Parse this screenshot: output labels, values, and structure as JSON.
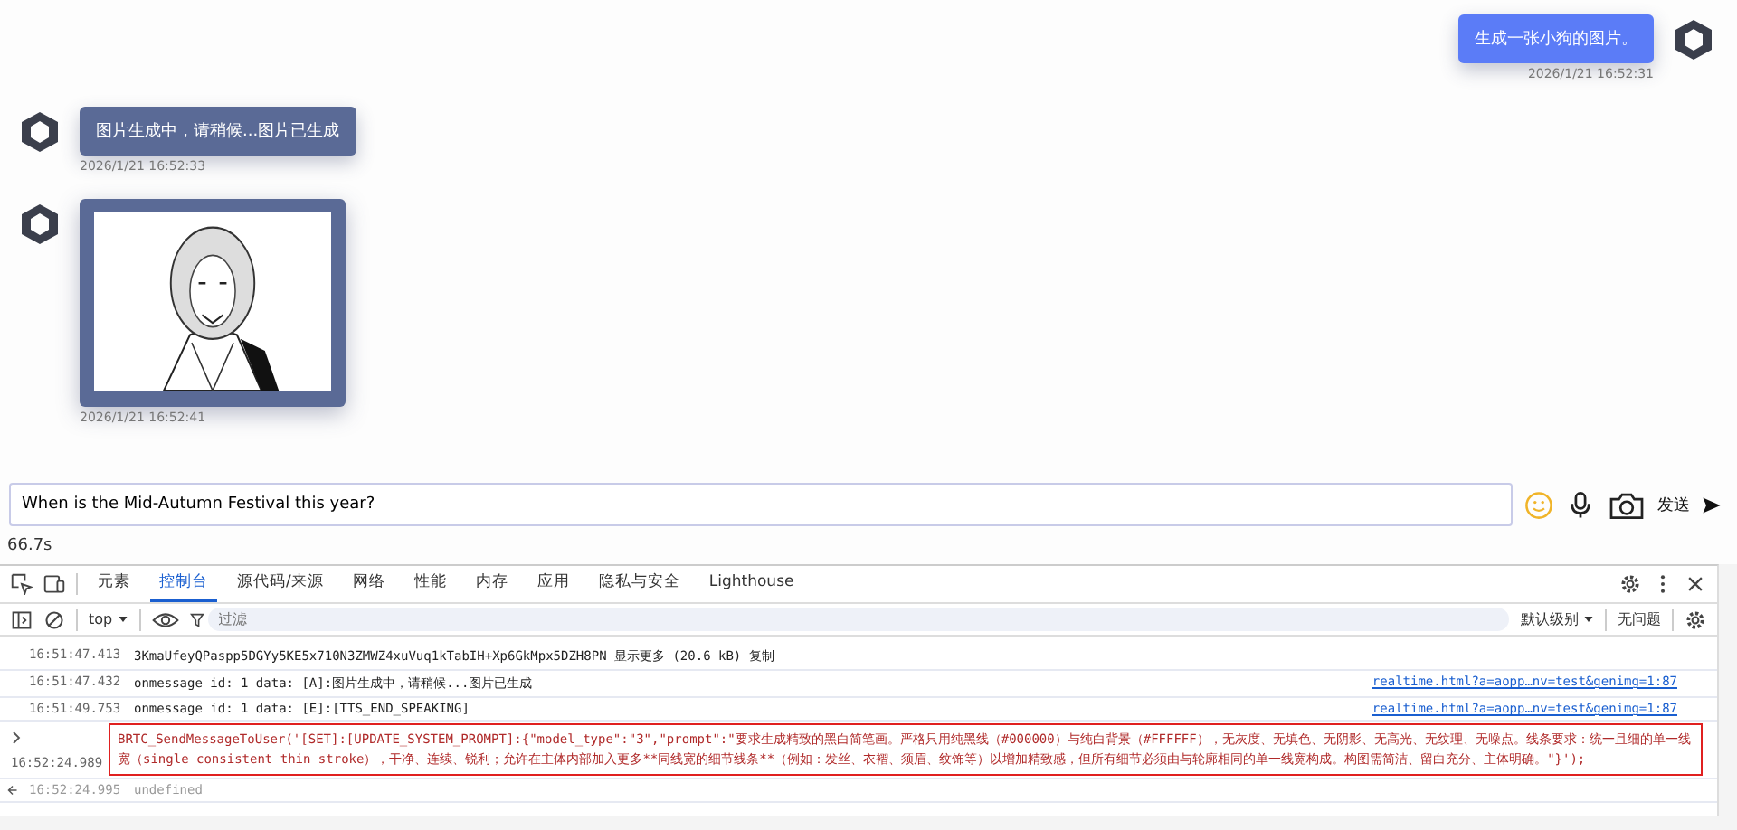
{
  "chat": {
    "messages": [
      {
        "kind": "user",
        "text": "生成一张小狗的图片。",
        "time": "2026/1/21 16:52:31"
      },
      {
        "kind": "bot",
        "text": "图片生成中，请稍候...图片已生成",
        "time": "2026/1/21 16:52:33"
      },
      {
        "time": "2026/1/21 16:52:41"
      }
    ]
  },
  "composer": {
    "value": "When is the Mid-Autumn Festival this year?",
    "send": "发送"
  },
  "elapsed": "66.7s",
  "devtools": {
    "tabs": [
      {
        "label": "元素",
        "selected": false
      },
      {
        "label": "控制台",
        "selected": true
      },
      {
        "label": "源代码/来源",
        "selected": false
      },
      {
        "label": "网络",
        "selected": false
      },
      {
        "label": "性能",
        "selected": false
      },
      {
        "label": "内存",
        "selected": false
      },
      {
        "label": "应用",
        "selected": false
      },
      {
        "label": "隐私与安全",
        "selected": false
      },
      {
        "label": "Lighthouse",
        "selected": false
      }
    ],
    "context": "top",
    "filter_placeholder": "过滤",
    "level": "默认级别",
    "issues": "无问题",
    "logs": [
      {
        "kind": "log",
        "time": "16:51:47.413",
        "text": "3KmaUfeyQPaspp5DGYy5KE5x710N3ZMWZ4xuVuq1kTabIH+Xp6GkMpx5DZH8PN 显示更多 (20.6 kB)  复制"
      },
      {
        "kind": "log",
        "time": "16:51:47.432",
        "text": "onmessage id: 1 data: [A]:图片生成中，请稍候...图片已生成",
        "source": "realtime.html?a=aopp…nv=test&genimg=1:87"
      },
      {
        "kind": "log",
        "time": "16:51:49.753",
        "text": "onmessage id: 1 data: [E]:[TTS_END_SPEAKING]",
        "source": "realtime.html?a=aopp…nv=test&genimg=1:87"
      },
      {
        "kind": "input",
        "time": "16:52:24.989",
        "text": "BRTC_SendMessageToUser('[SET]:[UPDATE_SYSTEM_PROMPT]:{\"model_type\":\"3\",\"prompt\":\"要求生成精致的黑白简笔画。严格只用纯黑线（#000000）与纯白背景（#FFFFFF），无灰度、无填色、无阴影、无高光、无纹理、无噪点。线条要求：统一且细的单一线宽（single consistent thin stroke），干净、连续、锐利；允许在主体内部加入更多**同线宽的细节线条**（例如：发丝、衣褶、须眉、纹饰等）以增加精致感，但所有细节必须由与轮廓相同的单一线宽构成。构图需简洁、留白充分、主体明确。\"}');"
      },
      {
        "kind": "result",
        "time": "16:52:24.995",
        "text": "undefined"
      }
    ]
  }
}
